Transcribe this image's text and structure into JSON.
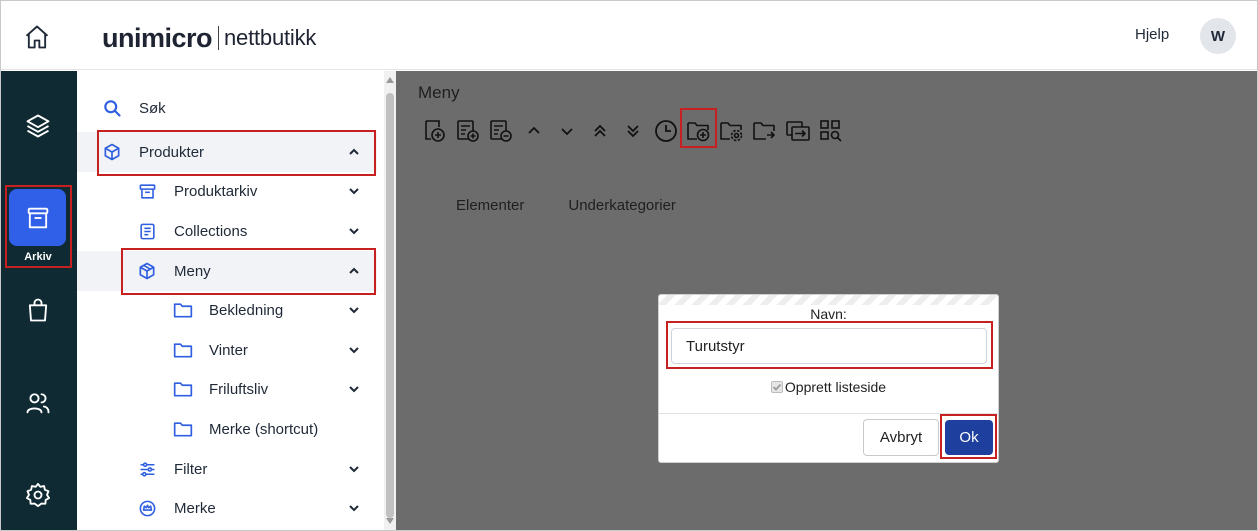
{
  "header": {
    "brand": "unimicro",
    "product": "nettbutikk",
    "help_label": "Hjelp",
    "avatar_initial": "W"
  },
  "rail": {
    "active_label": "Arkiv",
    "items": [
      "home-icon",
      "layers-icon",
      "archive-icon",
      "shopping-bag-icon",
      "users-icon",
      "gear-icon"
    ]
  },
  "nav": {
    "search": "Søk",
    "produkter": "Produkter",
    "produktarkiv": "Produktarkiv",
    "collections": "Collections",
    "meny": "Meny",
    "bekledning": "Bekledning",
    "vinter": "Vinter",
    "friluftsliv": "Friluftsliv",
    "merke_shortcut": "Merke (shortcut)",
    "filter": "Filter",
    "merke": "Merke"
  },
  "main": {
    "title": "Meny",
    "tabs": [
      "Elementer",
      "Underkategorier"
    ]
  },
  "dialog": {
    "field_label": "Navn:",
    "field_value": "Turutstyr",
    "checkbox_label": "Opprett listeside",
    "checkbox_checked": true,
    "cancel_label": "Avbryt",
    "ok_label": "Ok"
  },
  "colors": {
    "rail_bg": "#0f2a33",
    "rail_active": "#2f60e7",
    "accent_icon": "#2f5fe0",
    "overlay_bg": "#6c6c6c",
    "ok_button": "#1e3f9e",
    "highlight": "#c62020"
  }
}
